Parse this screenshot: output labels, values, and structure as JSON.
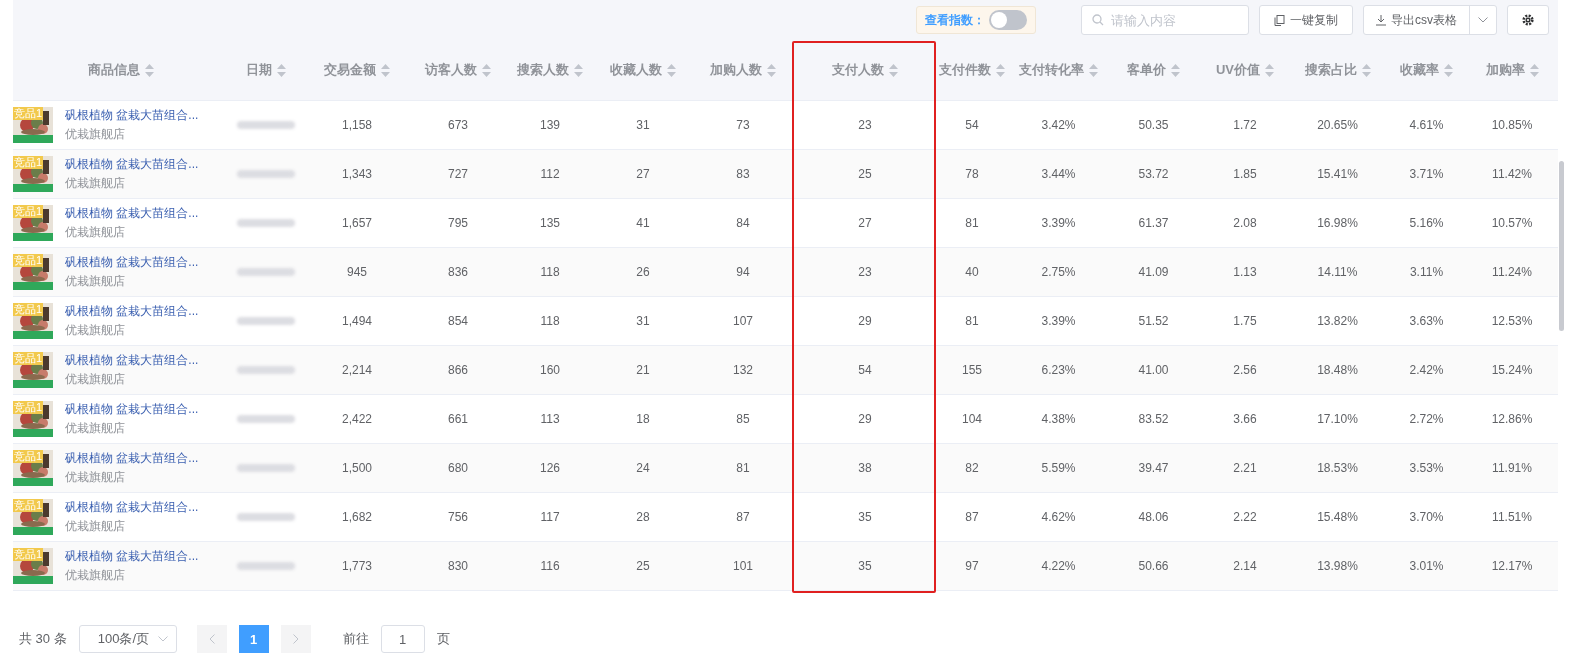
{
  "toolbar": {
    "index_toggle": {
      "label": "查看指数：",
      "on": false
    },
    "search": {
      "placeholder": "请输入内容"
    },
    "copy_button": "一键复制",
    "export_button": "导出csv表格"
  },
  "table": {
    "product_column": {
      "label": "商品信息"
    },
    "date_column": {
      "label": "日期"
    },
    "metric_columns": [
      {
        "label": "交易金额",
        "highlighted": false
      },
      {
        "label": "访客人数",
        "highlighted": false
      },
      {
        "label": "搜索人数",
        "highlighted": false
      },
      {
        "label": "收藏人数",
        "highlighted": false
      },
      {
        "label": "加购人数",
        "highlighted": false
      },
      {
        "label": "支付人数",
        "highlighted": true
      },
      {
        "label": "支付件数",
        "highlighted": false
      },
      {
        "label": "支付转化率",
        "highlighted": false
      },
      {
        "label": "客单价",
        "highlighted": false
      },
      {
        "label": "UV价值",
        "highlighted": false
      },
      {
        "label": "搜索占比",
        "highlighted": false
      },
      {
        "label": "收藏率",
        "highlighted": false
      },
      {
        "label": "加购率",
        "highlighted": false
      }
    ],
    "rows": [
      {
        "badge": "竞品1",
        "title": "矾根植物 盆栽大苗组合...",
        "shop": "优栽旗舰店",
        "metrics": [
          "1,158",
          "673",
          "139",
          "31",
          "73",
          "23",
          "54",
          "3.42%",
          "50.35",
          "1.72",
          "20.65%",
          "4.61%",
          "10.85%"
        ]
      },
      {
        "badge": "竞品1",
        "title": "矾根植物 盆栽大苗组合...",
        "shop": "优栽旗舰店",
        "metrics": [
          "1,343",
          "727",
          "112",
          "27",
          "83",
          "25",
          "78",
          "3.44%",
          "53.72",
          "1.85",
          "15.41%",
          "3.71%",
          "11.42%"
        ]
      },
      {
        "badge": "竞品1",
        "title": "矾根植物 盆栽大苗组合...",
        "shop": "优栽旗舰店",
        "metrics": [
          "1,657",
          "795",
          "135",
          "41",
          "84",
          "27",
          "81",
          "3.39%",
          "61.37",
          "2.08",
          "16.98%",
          "5.16%",
          "10.57%"
        ]
      },
      {
        "badge": "竞品1",
        "title": "矾根植物 盆栽大苗组合...",
        "shop": "优栽旗舰店",
        "metrics": [
          "945",
          "836",
          "118",
          "26",
          "94",
          "23",
          "40",
          "2.75%",
          "41.09",
          "1.13",
          "14.11%",
          "3.11%",
          "11.24%"
        ]
      },
      {
        "badge": "竞品1",
        "title": "矾根植物 盆栽大苗组合...",
        "shop": "优栽旗舰店",
        "metrics": [
          "1,494",
          "854",
          "118",
          "31",
          "107",
          "29",
          "81",
          "3.39%",
          "51.52",
          "1.75",
          "13.82%",
          "3.63%",
          "12.53%"
        ]
      },
      {
        "badge": "竞品1",
        "title": "矾根植物 盆栽大苗组合...",
        "shop": "优栽旗舰店",
        "metrics": [
          "2,214",
          "866",
          "160",
          "21",
          "132",
          "54",
          "155",
          "6.23%",
          "41.00",
          "2.56",
          "18.48%",
          "2.42%",
          "15.24%"
        ]
      },
      {
        "badge": "竞品1",
        "title": "矾根植物 盆栽大苗组合...",
        "shop": "优栽旗舰店",
        "metrics": [
          "2,422",
          "661",
          "113",
          "18",
          "85",
          "29",
          "104",
          "4.38%",
          "83.52",
          "3.66",
          "17.10%",
          "2.72%",
          "12.86%"
        ]
      },
      {
        "badge": "竞品1",
        "title": "矾根植物 盆栽大苗组合...",
        "shop": "优栽旗舰店",
        "metrics": [
          "1,500",
          "680",
          "126",
          "24",
          "81",
          "38",
          "82",
          "5.59%",
          "39.47",
          "2.21",
          "18.53%",
          "3.53%",
          "11.91%"
        ]
      },
      {
        "badge": "竞品1",
        "title": "矾根植物 盆栽大苗组合...",
        "shop": "优栽旗舰店",
        "metrics": [
          "1,682",
          "756",
          "117",
          "28",
          "87",
          "35",
          "87",
          "4.62%",
          "48.06",
          "2.22",
          "15.48%",
          "3.70%",
          "11.51%"
        ]
      },
      {
        "badge": "竞品1",
        "title": "矾根植物 盆栽大苗组合...",
        "shop": "优栽旗舰店",
        "metrics": [
          "1,773",
          "830",
          "116",
          "25",
          "101",
          "35",
          "97",
          "4.22%",
          "50.66",
          "2.14",
          "13.98%",
          "3.01%",
          "12.17%"
        ]
      }
    ]
  },
  "pagination": {
    "total": "共 30 条",
    "page_size": "100条/页",
    "pages": [
      {
        "label": "1",
        "selected": true
      }
    ],
    "goto_label": "前往",
    "goto_value": "1",
    "page_suffix": "页"
  }
}
